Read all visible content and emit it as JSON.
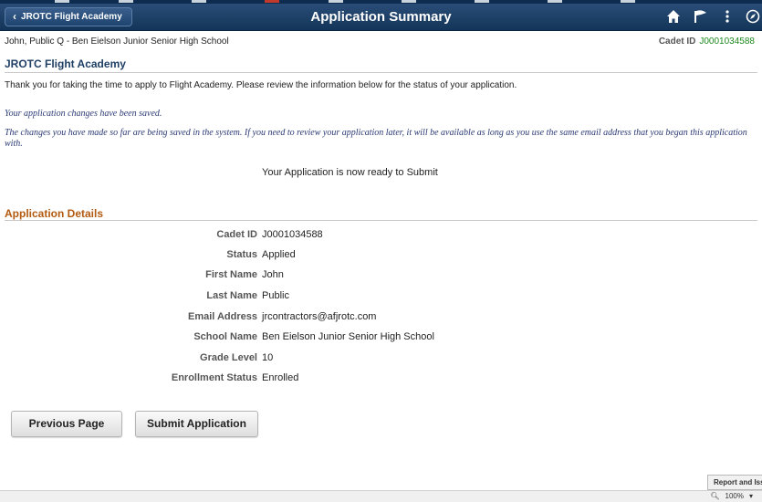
{
  "header": {
    "back_label": "JROTC Flight Academy",
    "title": "Application Summary",
    "icons": [
      "home-icon",
      "flag-icon",
      "more-vertical-icon",
      "compass-icon"
    ],
    "bg_color": "#133558"
  },
  "student": {
    "name_school": "John, Public Q -  Ben Eielson Junior Senior High School",
    "cadet_label": "Cadet ID",
    "cadet_id": "J0001034588"
  },
  "section_title": "JROTC Flight Academy",
  "intro_text": "Thank you for taking the time to apply to Flight Academy. Please review the information below for the status of your application.",
  "saved_msg": "Your application changes have been saved.",
  "saved_detail": "The changes you have made so far are being saved in the system. If you need to review your application later, it will be available as long as you use the same email address that you began this application with.",
  "ready_msg": "Your Application is now ready to Submit",
  "details": {
    "title": "Application Details",
    "rows": [
      {
        "label": "Cadet ID",
        "value": "J0001034588"
      },
      {
        "label": "Status",
        "value": "Applied"
      },
      {
        "label": "First Name",
        "value": "John"
      },
      {
        "label": "Last Name",
        "value": "Public"
      },
      {
        "label": "Email Address",
        "value": "jrcontractors@afjrotc.com"
      },
      {
        "label": "School Name",
        "value": "Ben Eielson Junior Senior High School"
      },
      {
        "label": "Grade Level",
        "value": "10"
      },
      {
        "label": "Enrollment Status",
        "value": "Enrolled"
      }
    ]
  },
  "buttons": {
    "previous": "Previous Page",
    "submit": "Submit Application"
  },
  "report_label": "Report and Issue",
  "zoom_level": "100%"
}
